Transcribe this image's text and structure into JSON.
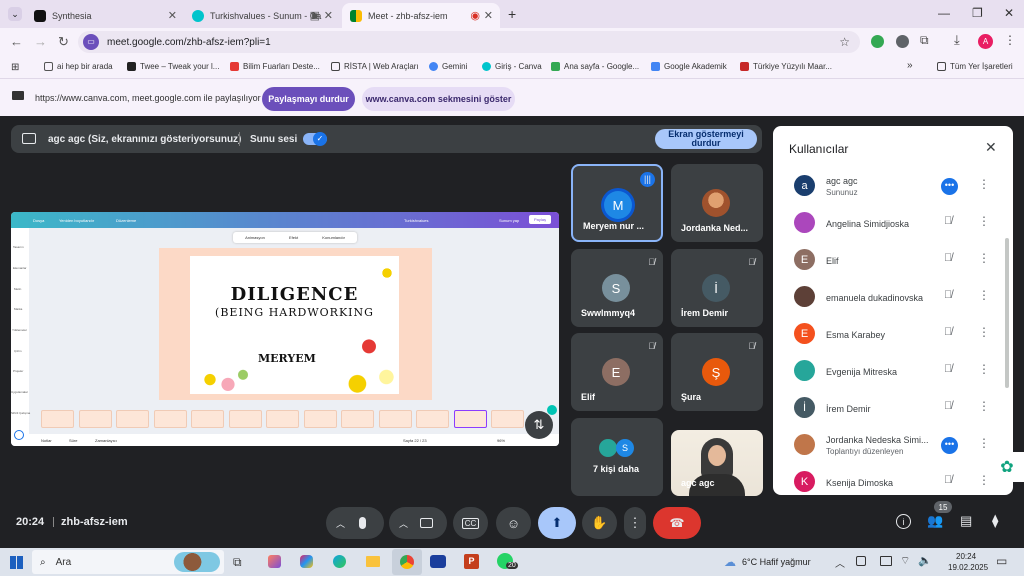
{
  "browser": {
    "tabs": [
      {
        "label": "Synthesia",
        "color": "#111"
      },
      {
        "label": "Turkishvalues - Sunum - Ca",
        "color": "#00c4cc"
      },
      {
        "label": "Meet - zhb-afsz-iem",
        "color": "#00832d"
      }
    ],
    "new_tab": "+",
    "url": "meet.google.com/zhb-afsz-iem?pli=1",
    "profile_initial": "A",
    "bookmarks": [
      "ai hep bir arada",
      "Twee – Tweak your l...",
      "Bilim Fuarları Deste...",
      "RİSTA | Web Araçları",
      "Gemini",
      "Giriş - Canva",
      "Ana sayfa - Google...",
      "Google Akademik",
      "Türkiye Yüzyılı Maar..."
    ],
    "bookmarks_more": "»",
    "bookmarks_folder": "Tüm Yer İşaretleri"
  },
  "share_banner": {
    "text": "https://www.canva.com, meet.google.com ile paylaşılıyor",
    "stop_label": "Paylaşmayı durdur",
    "show_tab_label": "www.canva.com sekmesini göster"
  },
  "meet": {
    "presenting_text": "agc agc (Siz, ekranınızı gösteriyorsunuz)",
    "audio_label": "Sunu sesi",
    "stop_presenting_label": "Ekran göstermeyi durdur",
    "slide": {
      "title": "DILIGENCE",
      "subtitle": "(BEING HARDWORKING",
      "author": "MERYEM",
      "page_info": "Sayfa 22 / 23",
      "zoom": "96%",
      "notes": "Notlar",
      "duration": "Süre",
      "timer": "Zamanlayıcı"
    },
    "canva_menu": [
      "Dosya",
      "Yeniden boyutlandır",
      "Düzenleme"
    ],
    "canva_title": "Turkishvalues",
    "canva_share": "Paylaş",
    "canva_present": "Sunum yap",
    "canva_float": [
      "Animasyon",
      "Efekt",
      "Konumlandır"
    ],
    "canva_side": [
      "Tasarım",
      "Elemanlar",
      "Metin",
      "Marka",
      "Yüklemeler",
      "Çizim",
      "Projeler",
      "Uygulamalar",
      "Sihirli Çalışma"
    ],
    "tiles": [
      {
        "name": "Meryem nur ...",
        "initial": "M",
        "color": "#1e88e5",
        "speaking": true
      },
      {
        "name": "Jordanka Ned...",
        "initial": "",
        "color": "#c0764a",
        "speaking": false
      },
      {
        "name": "Swwlmmyq4",
        "initial": "S",
        "color": "#78909c",
        "speaking": false
      },
      {
        "name": "İrem Demir",
        "initial": "İ",
        "color": "#455a64",
        "speaking": false
      },
      {
        "name": "Elif",
        "initial": "E",
        "color": "#8d6e63",
        "speaking": false
      },
      {
        "name": "Şura",
        "initial": "Ş",
        "color": "#e8590c",
        "speaking": false
      }
    ],
    "more_people": "7 kişi daha",
    "self_name": "agc agc",
    "time": "20:24",
    "meeting_code": "zhb-afsz-iem",
    "participant_count": "15",
    "people_panel": {
      "title": "Kullanıcılar",
      "people": [
        {
          "name": "agc agc",
          "sub": "Sununuz",
          "initial": "a",
          "color": "#1a3e6e",
          "state": "speaking"
        },
        {
          "name": "Angelina Simidjioska",
          "sub": "",
          "initial": "",
          "color": "#ab47bc",
          "state": "muted"
        },
        {
          "name": "Elif",
          "sub": "",
          "initial": "E",
          "color": "#8d6e63",
          "state": "muted"
        },
        {
          "name": "emanuela dukadinovska",
          "sub": "",
          "initial": "",
          "color": "#5d4037",
          "state": "muted"
        },
        {
          "name": "Esma Karabey",
          "sub": "",
          "initial": "E",
          "color": "#f4511e",
          "state": "muted"
        },
        {
          "name": "Evgenija Mitreska",
          "sub": "",
          "initial": "",
          "color": "#26a69a",
          "state": "muted"
        },
        {
          "name": "İrem Demir",
          "sub": "",
          "initial": "İ",
          "color": "#455a64",
          "state": "muted"
        },
        {
          "name": "Jordanka Nedeska Simi...",
          "sub": "Toplantıyı düzenleyen",
          "initial": "",
          "color": "#c0764a",
          "state": "speaking"
        },
        {
          "name": "Ksenija Dimoska",
          "sub": "",
          "initial": "K",
          "color": "#d81b60",
          "state": "muted"
        }
      ]
    }
  },
  "taskbar": {
    "search": "Ara",
    "weather": "6°C  Hafif yağmur",
    "time": "20:24",
    "date": "19.02.2025",
    "whatsapp_badge": "20"
  }
}
